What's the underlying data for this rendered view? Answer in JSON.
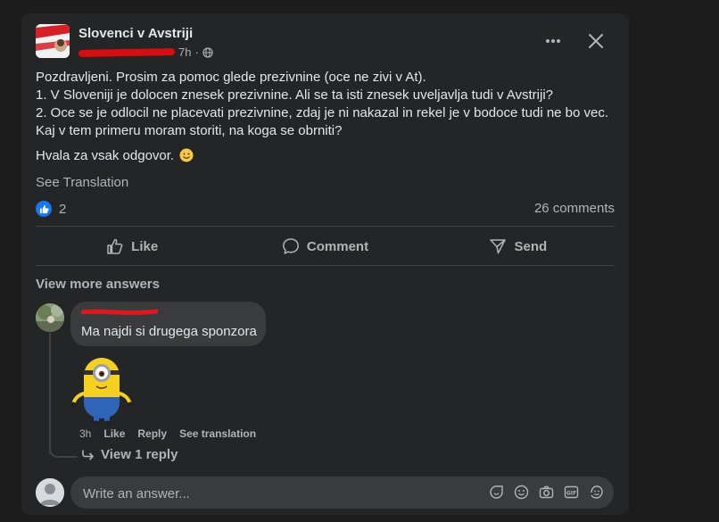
{
  "post": {
    "group_name": "Slovenci v Avstriji",
    "time": "7h",
    "lines": [
      "Pozdravljeni. Prosim za pomoc glede prezivnine (oce ne zivi v At).",
      "1. V Sloveniji je dolocen znesek prezivnine. Ali se ta isti znesek uveljavlja tudi v Avstriji?",
      "2. Oce se je odlocil ne placevati prezivnine, zdaj je ni nakazal in rekel je v bodoce tudi ne bo vec.",
      "Kaj v tem primeru moram storiti, na koga se obrniti?"
    ],
    "thanks": "Hvala za vsak odgovor.",
    "see_translation": "See Translation",
    "likes": "2",
    "comments": "26 comments"
  },
  "actions": {
    "like": "Like",
    "comment": "Comment",
    "send": "Send"
  },
  "comments_section": {
    "view_more": "View more answers",
    "comment": {
      "text": "Ma najdi si drugega sponzora",
      "time": "3h",
      "like": "Like",
      "reply": "Reply",
      "see_translation": "See translation",
      "view_reply": "View 1 reply"
    }
  },
  "composer": {
    "placeholder": "Write an answer...",
    "icons": [
      "sticker-icon",
      "emoji-icon",
      "camera-icon",
      "gif-icon",
      "avatar-sticker-icon"
    ]
  },
  "colors": {
    "card": "#242526",
    "bubble": "#3a3b3c",
    "text": "#e4e6eb",
    "muted": "#b0b3b8",
    "blue": "#1877f2"
  }
}
